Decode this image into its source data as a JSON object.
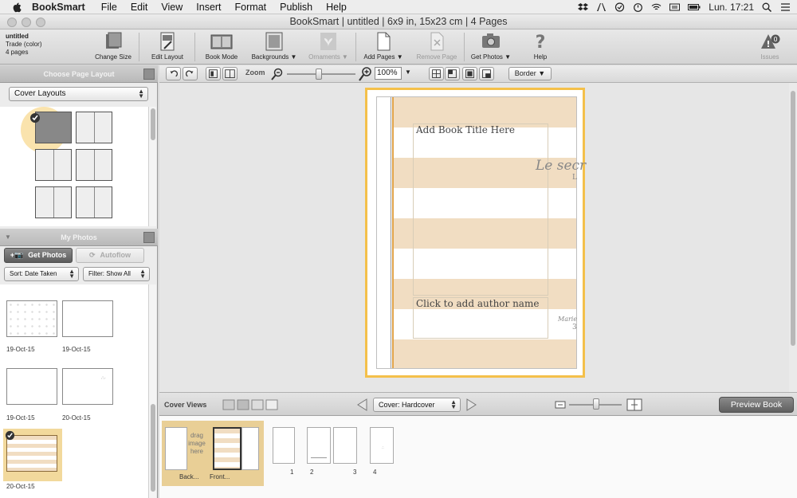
{
  "menubar": {
    "app_name": "BookSmart",
    "items": [
      "File",
      "Edit",
      "View",
      "Insert",
      "Format",
      "Publish",
      "Help"
    ],
    "clock": "Lun. 17:21"
  },
  "window": {
    "title": "BookSmart  |  untitled  |  6x9 in, 15x23 cm  |  4 Pages"
  },
  "doc_info": {
    "name": "untitled",
    "type": "Trade (color)",
    "pages": "4 pages"
  },
  "toolbar": {
    "change_size": "Change Size",
    "edit_layout": "Edit Layout",
    "book_mode": "Book Mode",
    "backgrounds": "Backgrounds ▼",
    "ornaments": "Ornaments ▼",
    "add_pages": "Add Pages ▼",
    "remove_page": "Remove Page",
    "get_photos": "Get Photos ▼",
    "help": "Help",
    "issues": "Issues",
    "issues_count": "0"
  },
  "layout_panel": {
    "header": "Choose Page Layout",
    "category": "Cover Layouts"
  },
  "photos_panel": {
    "header": "My Photos",
    "get_photos": "Get Photos",
    "autoflow": "Autoflow",
    "sort": "Sort:  Date Taken",
    "filter": "Filter: Show All",
    "photos": [
      {
        "date": "19-Oct-15"
      },
      {
        "date": "19-Oct-15"
      },
      {
        "date": "19-Oct-15"
      },
      {
        "date": "20-Oct-15"
      },
      {
        "date": "20-Oct-15"
      }
    ]
  },
  "canvas_toolbar": {
    "zoom_label": "Zoom",
    "zoom_value": "100%",
    "zoom_level": 0.45,
    "border_label": "Border ▼"
  },
  "cover": {
    "title_placeholder": "Add Book Title Here",
    "author_placeholder": "Click to add author name",
    "script_top": "Le secr",
    "script_bottom": "Marie",
    "script_top_small": "L",
    "script_bottom_small": "3",
    "colors": {
      "stripe": "#f1ddc2",
      "selection": "#f4c04a"
    }
  },
  "bottom_bar": {
    "cover_views_label": "Cover Views",
    "cover_type": "Cover: Hardcover",
    "preview_button": "Preview Book",
    "page_zoom": 0.5
  },
  "pages_strip": {
    "drag_text": "drag image here",
    "back_label": "Back...",
    "front_label": "Front...",
    "page_numbers": [
      "1",
      "2",
      "3",
      "4"
    ]
  }
}
